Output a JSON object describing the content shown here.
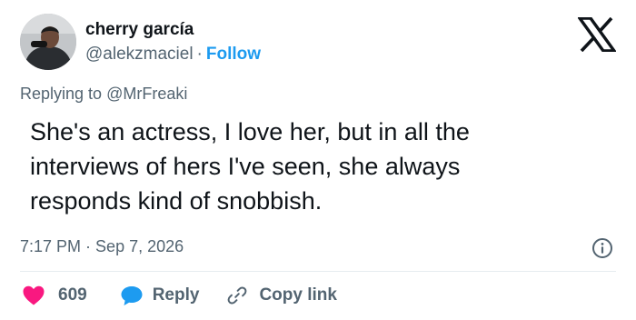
{
  "author": {
    "name": "cherry garcía",
    "handle": "@alekzmaciel",
    "separator": "·",
    "follow_label": "Follow"
  },
  "reply_context": {
    "prefix": "Replying to",
    "mention": "@MrFreaki"
  },
  "tweet": {
    "line1": "She's an actress, I love her, but in all the",
    "line2": "interviews of hers I've seen, she always",
    "line3": "responds kind of snobbish."
  },
  "meta": {
    "time": "7:17 PM",
    "separator": "·",
    "date": "Sep 7, 2026"
  },
  "actions": {
    "like_count": "609",
    "reply_label": "Reply",
    "copy_label": "Copy link"
  },
  "colors": {
    "text": "#0f1419",
    "secondary": "#536471",
    "accent": "#1d9bf0",
    "like": "#f91880",
    "reply": "#1d9bf0"
  },
  "icons": {
    "brand": "x-logo-icon",
    "info": "info-icon",
    "like": "heart-icon",
    "reply": "speech-bubble-icon",
    "copy": "link-icon"
  }
}
